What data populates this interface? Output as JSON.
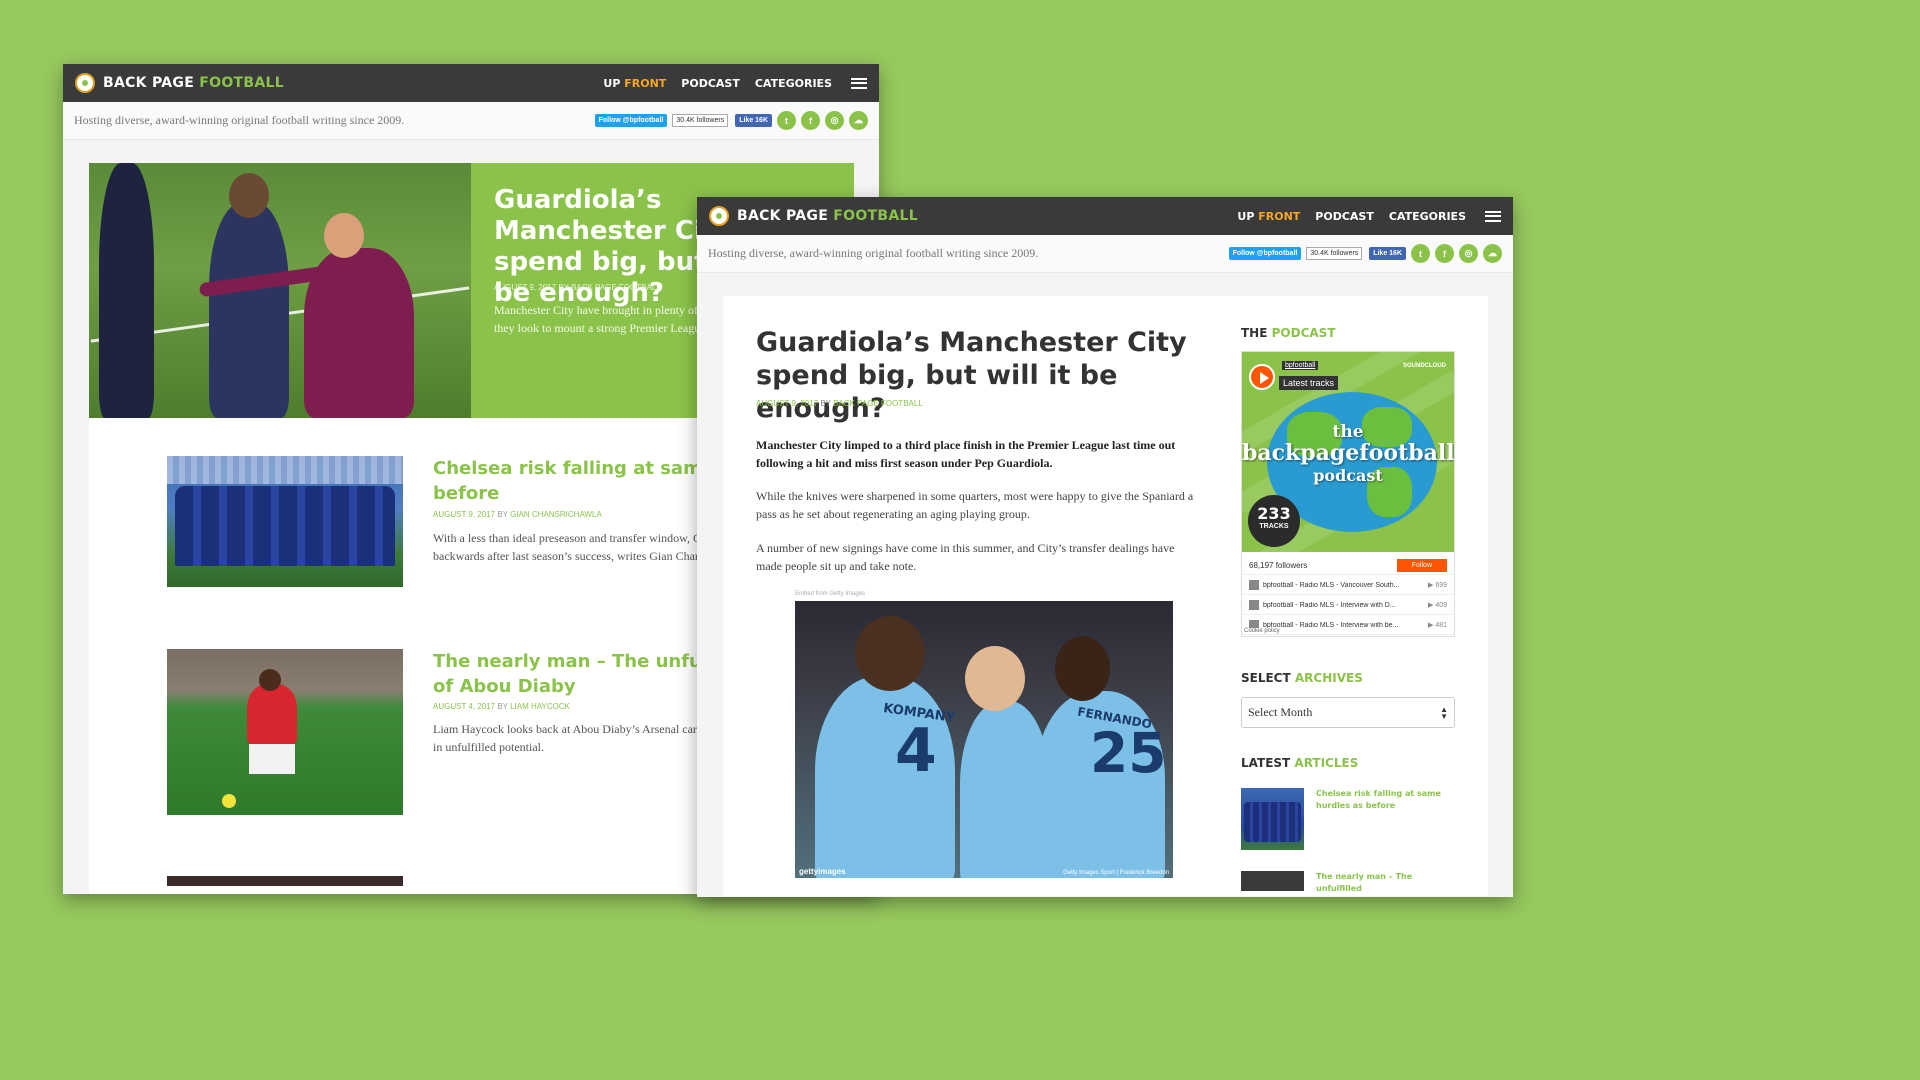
{
  "site": {
    "logo_text": "BACK PAGE",
    "logo_accent": "FOOTBALL",
    "nav": {
      "upfront_a": "UP",
      "upfront_b": "FRONT",
      "podcast": "PODCAST",
      "categories": "CATEGORIES"
    },
    "tagline": "Hosting diverse, award-winning original football writing since 2009.",
    "social": {
      "twitter_follow": "Follow @bpfootball",
      "twitter_count": "30.4K followers",
      "fb_like": "Like 16K"
    },
    "colors": {
      "accent": "#8bc34a",
      "nav_bg": "#3a3a3a",
      "orange": "#f5a623",
      "page_bg": "#97c95e"
    }
  },
  "back_window": {
    "hero": {
      "title": "Guardiola’s Manchester City spend big, but will it be enough?",
      "meta": "AUGUST 9, 2017 BY BACK PAGE FOOTBALL",
      "excerpt": "Manchester City have brought in plenty of new signings as they look to mount a strong Premier League challenge."
    },
    "posts": [
      {
        "title": "Chelsea risk falling at same hurdles as before",
        "meta_date": "AUGUST 9, 2017",
        "meta_by": "BY",
        "meta_author": "GIAN CHANSRICHAWLA",
        "excerpt": "With a less than ideal preseason and transfer window, Chelsea risk going backwards after last season’s success, writes Gian Chansrichawla."
      },
      {
        "title": "The nearly man – The unfulfilled talent of Abou Diaby",
        "meta_date": "AUGUST 4, 2017",
        "meta_by": "BY",
        "meta_author": "LIAM HAYCOCK",
        "excerpt": "Liam Haycock looks back at Abou Diaby’s Arsenal career, where bad luck resulted in unfulfilled potential."
      }
    ]
  },
  "front_window": {
    "article": {
      "title": "Guardiola’s Manchester City spend big, but will it be enough?",
      "meta_date": "AUGUST 9, 2017",
      "meta_by": "BY",
      "meta_author": "BACK PAGE FOOTBALL",
      "lead": "Manchester City limped to a third place finish in the Premier League last time out following a hit and miss first season under Pep Guardiola.",
      "p1": "While the knives were sharpened in some quarters, most were happy to give the Spaniard a pass as he set about regenerating an aging playing group.",
      "p2": "A number of new signings have come in this summer, and City’s transfer dealings have made people sit up and take note.",
      "embed_label": "Embed from Getty Images",
      "getty_logo": "gettyimages",
      "getty_credit": "Getty Images Sport | Frederick Breedon",
      "shirt_name_1": "KOMPANY",
      "shirt_num_1": "4",
      "shirt_name_2": "FERNANDO",
      "shirt_num_2": "25"
    },
    "sidebar": {
      "podcast_heading_a": "THE",
      "podcast_heading_b": "PODCAST",
      "podcast": {
        "user": "bpfootball",
        "latest": "Latest tracks",
        "soundcloud": "SOUNDCLOUD",
        "title_1": "the",
        "title_2": "backpagefootball",
        "title_3": "podcast",
        "tracks_num": "233",
        "tracks_label": "TRACKS",
        "followers": "68,197 followers",
        "follow_btn": "Follow",
        "tracks": [
          {
            "name": "bpfootball - Radio MLS - Vancouver South...",
            "plays": "699"
          },
          {
            "name": "bpfootball - Radio MLS - Interview with D...",
            "plays": "409"
          },
          {
            "name": "bpfootball - Radio MLS - Interview with be...",
            "plays": "481"
          }
        ],
        "cookie": "Cookie policy"
      },
      "archives_a": "SELECT",
      "archives_b": "ARCHIVES",
      "select_month": "Select Month",
      "latest_a": "LATEST",
      "latest_b": "ARTICLES",
      "latest_items": [
        {
          "title": "Chelsea risk falling at same hurdles as before"
        },
        {
          "title": "The nearly man – The unfulfilled"
        }
      ]
    }
  }
}
